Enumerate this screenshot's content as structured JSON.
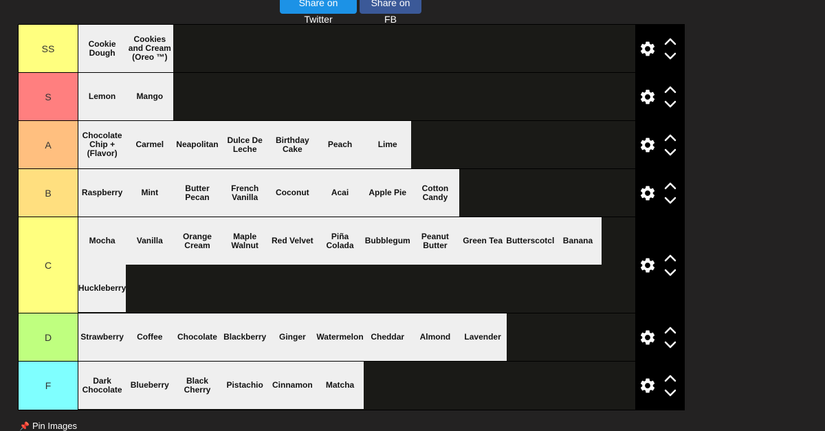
{
  "share": {
    "twitter_label": "Share on Twitter",
    "fb_label": "Share on FB"
  },
  "tiers": [
    {
      "label": "SS",
      "color": "#ffff7f",
      "items": [
        "Cookie Dough",
        "Cookies and Cream (Oreo ™)"
      ]
    },
    {
      "label": "S",
      "color": "#ff7f7f",
      "items": [
        "Lemon",
        "Mango"
      ]
    },
    {
      "label": "A",
      "color": "#ffbf7f",
      "items": [
        "Chocolate Chip + (Flavor)",
        "Carmel",
        "Neapolitan",
        "Dulce De Leche",
        "Birthday Cake",
        "Peach",
        "Lime"
      ]
    },
    {
      "label": "B",
      "color": "#ffdf7f",
      "items": [
        "Raspberry",
        "Mint",
        "Butter Pecan",
        "French Vanilla",
        "Coconut",
        "Acai",
        "Apple Pie",
        "Cotton Candy"
      ]
    },
    {
      "label": "C",
      "color": "#ffff7f",
      "items": [
        "Mocha",
        "Vanilla",
        "Orange Cream",
        "Maple Walnut",
        "Red Velvet",
        "Piña Colada",
        "Bubblegum",
        "Peanut Butter",
        "Green Tea",
        "Butterscotcl",
        "Banana",
        "Huckleberry"
      ]
    },
    {
      "label": "D",
      "color": "#bfff7f",
      "items": [
        "Strawberry",
        "Coffee",
        "Chocolate",
        "Blackberry",
        "Ginger",
        "Watermelon",
        "Cheddar",
        "Almond",
        "Lavender"
      ]
    },
    {
      "label": "F",
      "color": "#7fffff",
      "items": [
        "Dark Chocolate",
        "Blueberry",
        "Black Cherry",
        "Pistachio",
        "Cinnamon",
        "Matcha"
      ]
    }
  ],
  "footer": {
    "pin_label": "Pin Images"
  },
  "icons": {
    "settings": "gear-icon",
    "move_up": "chevron-up-icon",
    "move_down": "chevron-down-icon",
    "pin": "pushpin-icon"
  }
}
